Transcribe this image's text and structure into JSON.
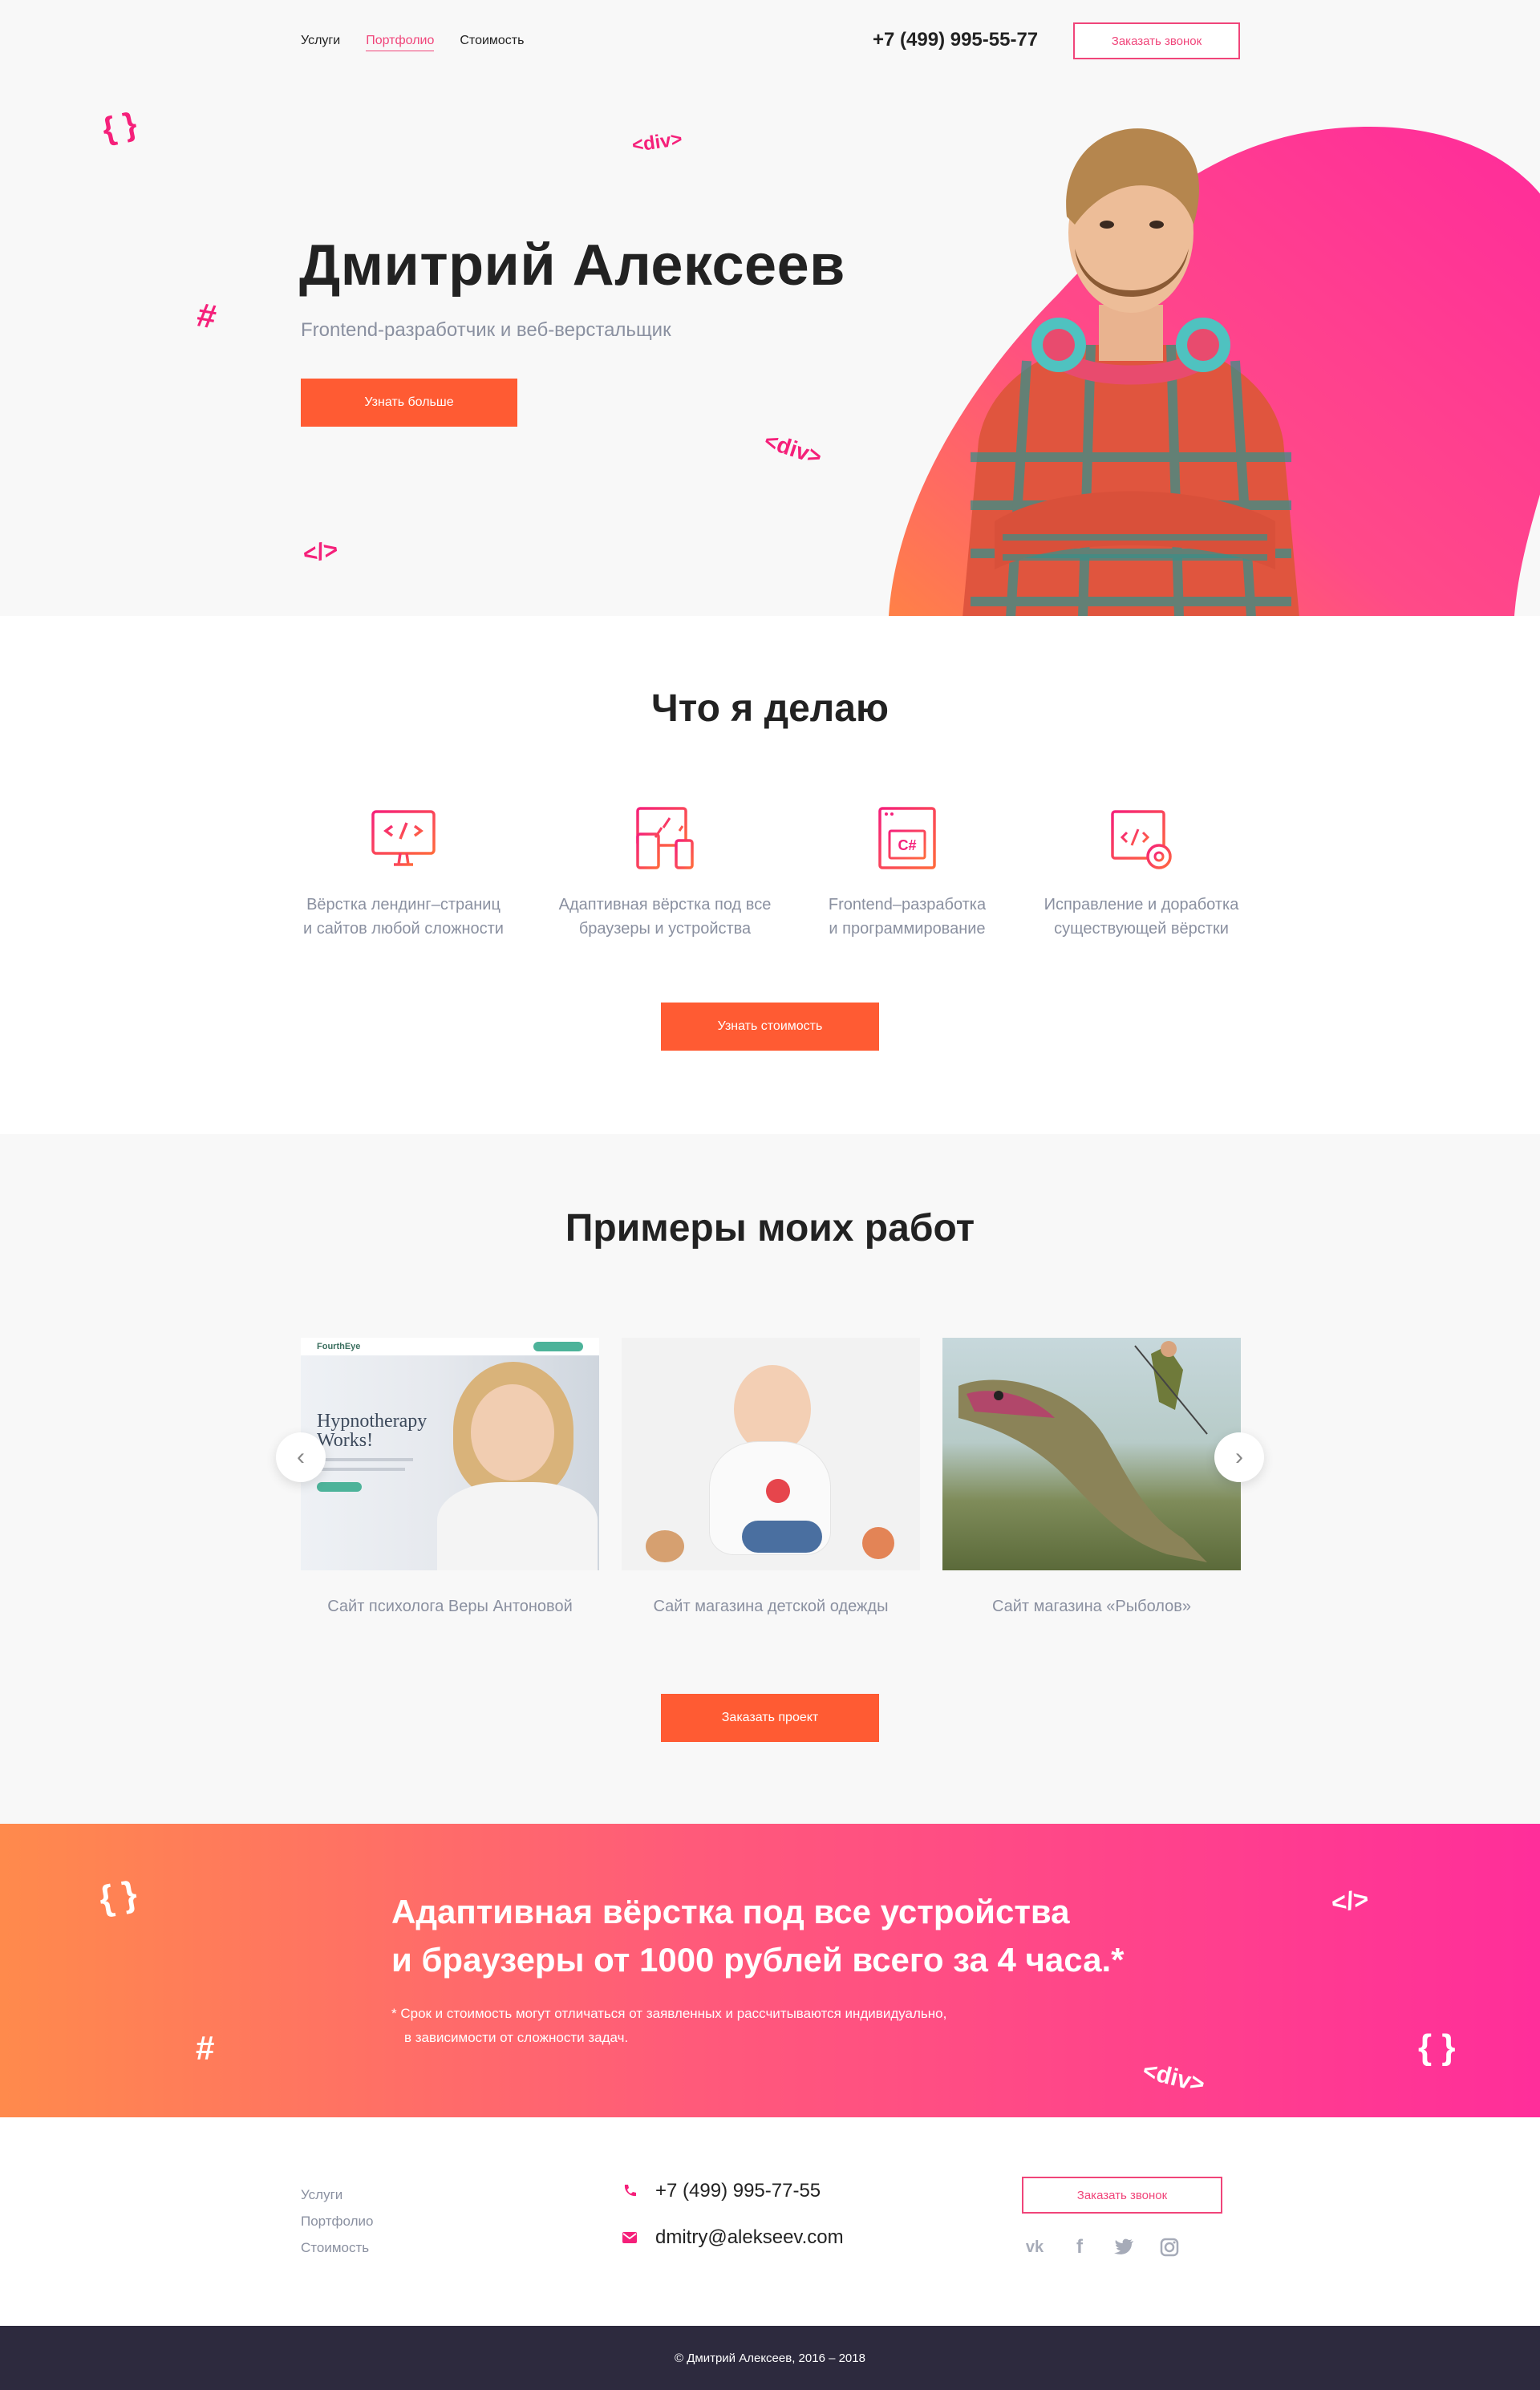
{
  "header": {
    "nav": [
      {
        "label": "Услуги"
      },
      {
        "label": "Портфолио"
      },
      {
        "label": "Стоимость"
      }
    ],
    "phone": "+7 (499) 995-55-77",
    "call_button": "Заказать звонок"
  },
  "hero": {
    "title": "Дмитрий Алексеев",
    "subtitle": "Frontend-разработчик и веб-верстальщик",
    "button": "Узнать больше",
    "decorations": [
      "{ }",
      "<div>",
      "#",
      "<div>",
      "</>"
    ]
  },
  "services": {
    "title": "Что я делаю",
    "items": [
      {
        "icon": "monitor-code-icon",
        "line1": "Вёрстка лендинг–страниц",
        "line2": "и сайтов любой сложности"
      },
      {
        "icon": "responsive-devices-icon",
        "line1": "Адаптивная вёрстка под все",
        "line2": "браузеры и устройства"
      },
      {
        "icon": "csharp-window-icon",
        "line1": "Frontend–разработка",
        "line2": "и программирование"
      },
      {
        "icon": "code-gear-icon",
        "line1": "Исправление и доработка",
        "line2": "существующей вёрстки"
      }
    ],
    "button": "Узнать стоимость"
  },
  "portfolio": {
    "title": "Примеры моих работ",
    "works": [
      {
        "caption": "Сайт психолога Веры Антоновой",
        "image_text": "Hypnotherapy Works!",
        "logo_text": "FourthEye"
      },
      {
        "caption": "Сайт магазина детской одежды"
      },
      {
        "caption": "Сайт магазина «Рыболов»"
      }
    ],
    "button": "Заказать проект"
  },
  "promo": {
    "line1": "Адаптивная вёрстка под все устройства",
    "line2": "и браузеры от 1000 рублей всего за 4 часа.*",
    "note1": "* Срок и стоимость могут отличаться от заявленных и рассчитываются  индивидуально,",
    "note2": "в зависимости от сложности задач."
  },
  "footer": {
    "nav": [
      {
        "label": "Услуги"
      },
      {
        "label": "Портфолио"
      },
      {
        "label": "Стоимость"
      }
    ],
    "phone": "+7 (499) 995-77-55",
    "email": "dmitry@alekseev.com",
    "call_button": "Заказать звонок",
    "social": [
      "vk-icon",
      "facebook-icon",
      "twitter-icon",
      "instagram-icon"
    ],
    "copyright": "© Дмитрий Алексеев, 2016 – 2018"
  },
  "colors": {
    "accent": "#f0457a",
    "button": "#ff5b33",
    "dark": "#2d2a3e"
  }
}
